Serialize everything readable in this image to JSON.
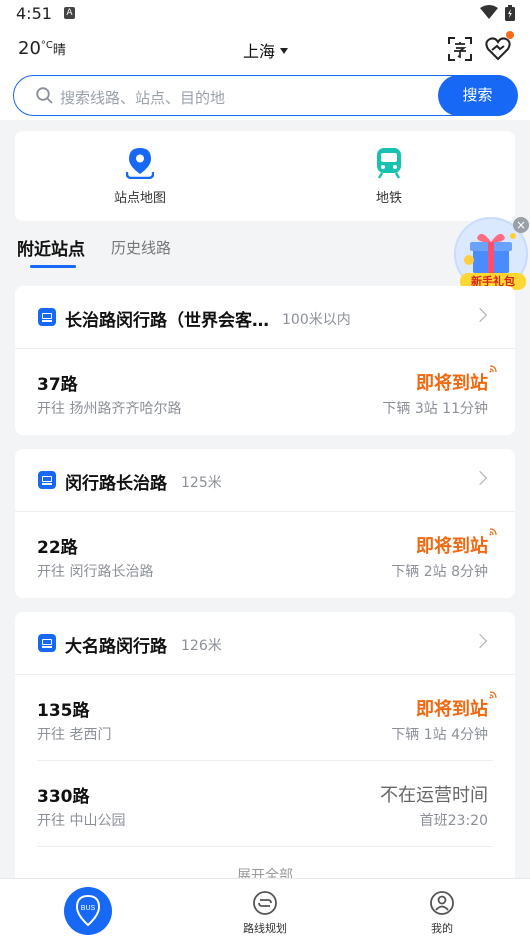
{
  "status_bar": {
    "time": "4:51",
    "notif_icon": "A"
  },
  "header": {
    "temperature": "20",
    "unit": "°C",
    "weather": "晴",
    "city": "上海"
  },
  "search": {
    "placeholder": "搜索线路、站点、目的地",
    "button": "搜索"
  },
  "quick": [
    {
      "label": "站点地图",
      "icon": "map-pin-icon"
    },
    {
      "label": "地铁",
      "icon": "metro-icon"
    }
  ],
  "tabs": {
    "nearby": "附近站点",
    "history": "历史线路"
  },
  "promo": {
    "label": "新手礼包"
  },
  "stops": [
    {
      "name": "长治路闵行路（世界会客…",
      "distance": "100米以内",
      "routes": [
        {
          "name": "37路",
          "direction": "开往 扬州路齐齐哈尔路",
          "status": "即将到站",
          "info": "下辆  3站 11分钟"
        }
      ]
    },
    {
      "name": "闵行路长治路",
      "distance": "125米",
      "routes": [
        {
          "name": "22路",
          "direction": "开往 闵行路长治路",
          "status": "即将到站",
          "info": "下辆  2站 8分钟"
        }
      ]
    },
    {
      "name": "大名路闵行路",
      "distance": "126米",
      "routes": [
        {
          "name": "135路",
          "direction": "开往 老西门",
          "status": "即将到站",
          "info": "下辆  1站 4分钟"
        },
        {
          "name": "330路",
          "direction": "开往 中山公园",
          "status": "不在运营时间",
          "info": "首班23:20"
        }
      ],
      "expand": "展开全部"
    }
  ],
  "bottom_nav": [
    {
      "label": "BUS"
    },
    {
      "label": "路线规划"
    },
    {
      "label": "我的"
    }
  ],
  "colors": {
    "accent": "#1668f5",
    "arriving": "#f0680f",
    "metro": "#19c2b0"
  }
}
